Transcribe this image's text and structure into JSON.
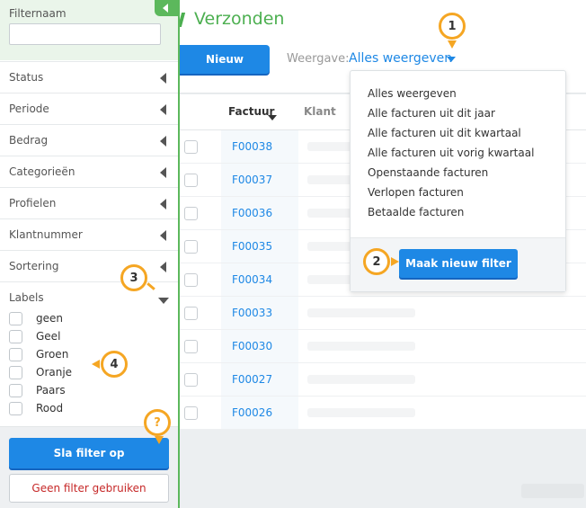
{
  "page": {
    "title": "Verzonden",
    "new_button": "Nieuw",
    "view_label": "Weergave:",
    "view_value": "Alles weergeven"
  },
  "table": {
    "col_invoice": "Factuur",
    "col_client": "Klant",
    "rows": [
      "F00038",
      "F00037",
      "F00036",
      "F00035",
      "F00034",
      "F00033",
      "F00030",
      "F00027",
      "F00026"
    ]
  },
  "dropdown": {
    "items": [
      "Alles weergeven",
      "Alle facturen uit dit jaar",
      "Alle facturen uit dit kwartaal",
      "Alle facturen uit vorig kwartaal",
      "Openstaande facturen",
      "Verlopen facturen",
      "Betaalde facturen"
    ],
    "new_filter_button": "Maak nieuw filter"
  },
  "sidebar": {
    "filter_name_label": "Filternaam",
    "filter_name_value": "",
    "sections": [
      "Status",
      "Periode",
      "Bedrag",
      "Categorieën",
      "Profielen",
      "Klantnummer",
      "Sortering"
    ],
    "labels_title": "Labels",
    "labels": [
      "geen",
      "Geel",
      "Groen",
      "Oranje",
      "Paars",
      "Rood"
    ],
    "save_button": "Sla filter op",
    "no_filter_button": "Geen filter gebruiken"
  },
  "markers": [
    "1",
    "2",
    "3",
    "4",
    "?"
  ],
  "colors": {
    "accent_blue": "#1e88e5",
    "brand_green": "#4caf50",
    "marker_orange": "#f5a623",
    "danger_red": "#c62828"
  }
}
